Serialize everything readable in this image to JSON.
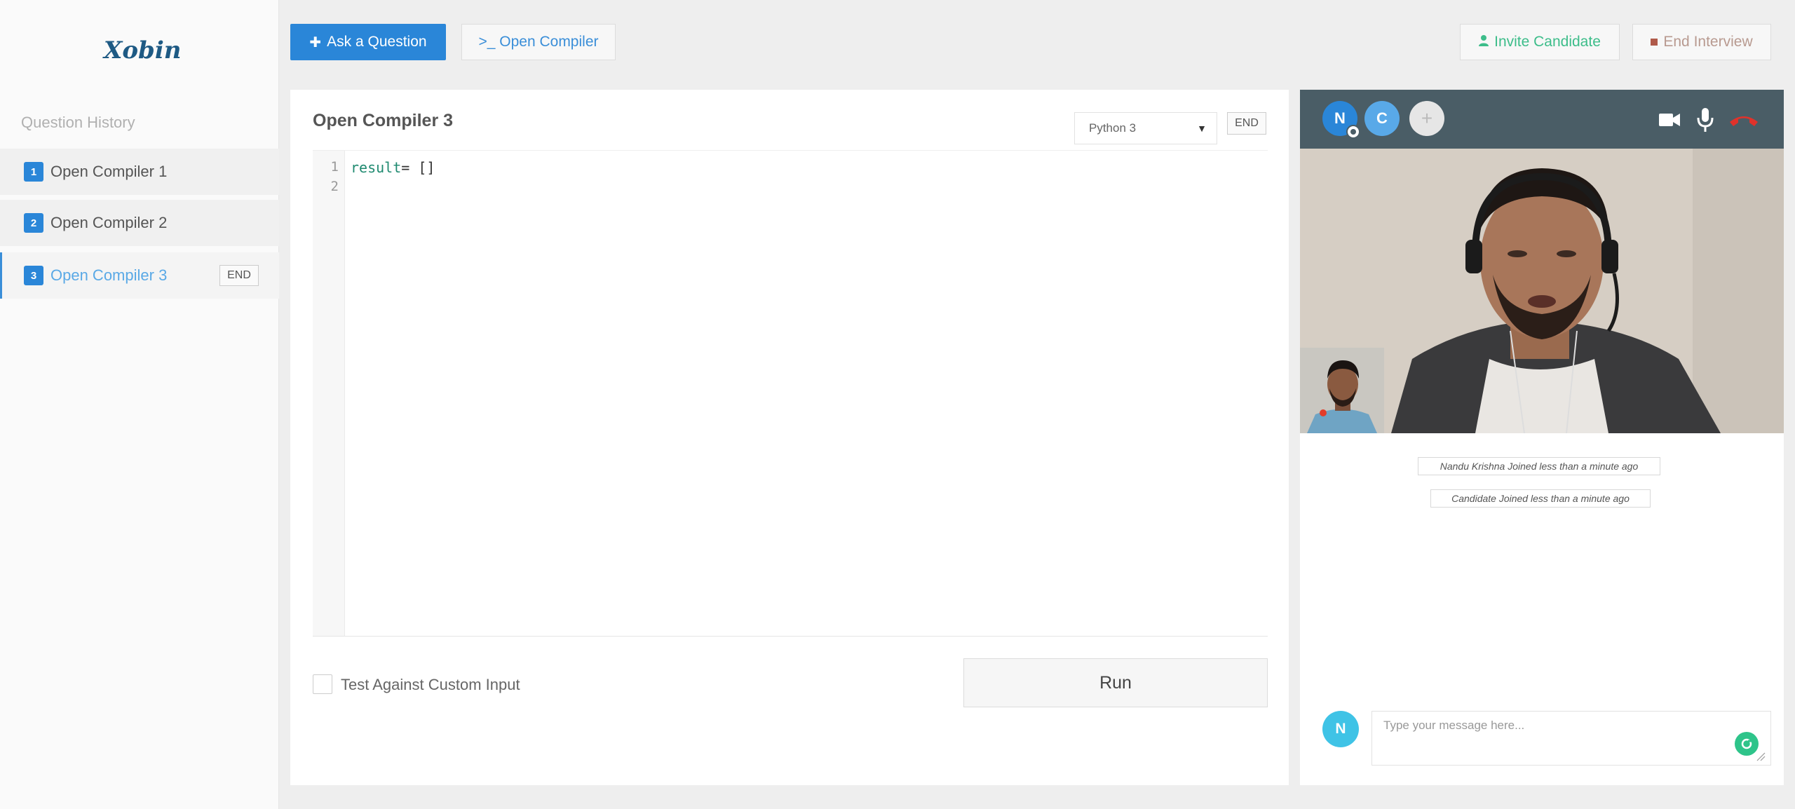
{
  "sidebar": {
    "logo": "Xobin",
    "heading": "Question History",
    "items": [
      {
        "num": "1",
        "label": "Open Compiler 1"
      },
      {
        "num": "2",
        "label": "Open Compiler 2"
      },
      {
        "num": "3",
        "label": "Open Compiler 3",
        "end_label": "END"
      }
    ]
  },
  "toolbar": {
    "ask_label": "Ask a Question",
    "compiler_label": ">_ Open Compiler",
    "invite_label": "Invite Candidate",
    "end_interview_label": "End Interview"
  },
  "editor": {
    "title": "Open Compiler 3",
    "language": "Python 3",
    "end_label": "END",
    "line_numbers": [
      "1",
      "2"
    ],
    "code_var": "result",
    "code_rest": "= []",
    "custom_input_label": "Test Against Custom Input",
    "custom_input_checked": false,
    "run_label": "Run"
  },
  "video": {
    "participants": [
      {
        "initial": "N"
      },
      {
        "initial": "C"
      }
    ],
    "add_label": "+",
    "messages": [
      "Nandu Krishna Joined less than a minute ago",
      "Candidate Joined less than a minute ago"
    ],
    "chat_avatar": "N",
    "chat_placeholder": "Type your message here..."
  },
  "colors": {
    "primary": "#2a86d8",
    "invite": "#3dbd8a",
    "video_bar": "#4a5d66",
    "hangup": "#e0322b"
  },
  "icons": [
    "plus-icon",
    "user-icon",
    "stop-icon",
    "camera-icon",
    "microphone-icon",
    "hangup-icon",
    "send-icon",
    "resize-grip-icon"
  ]
}
